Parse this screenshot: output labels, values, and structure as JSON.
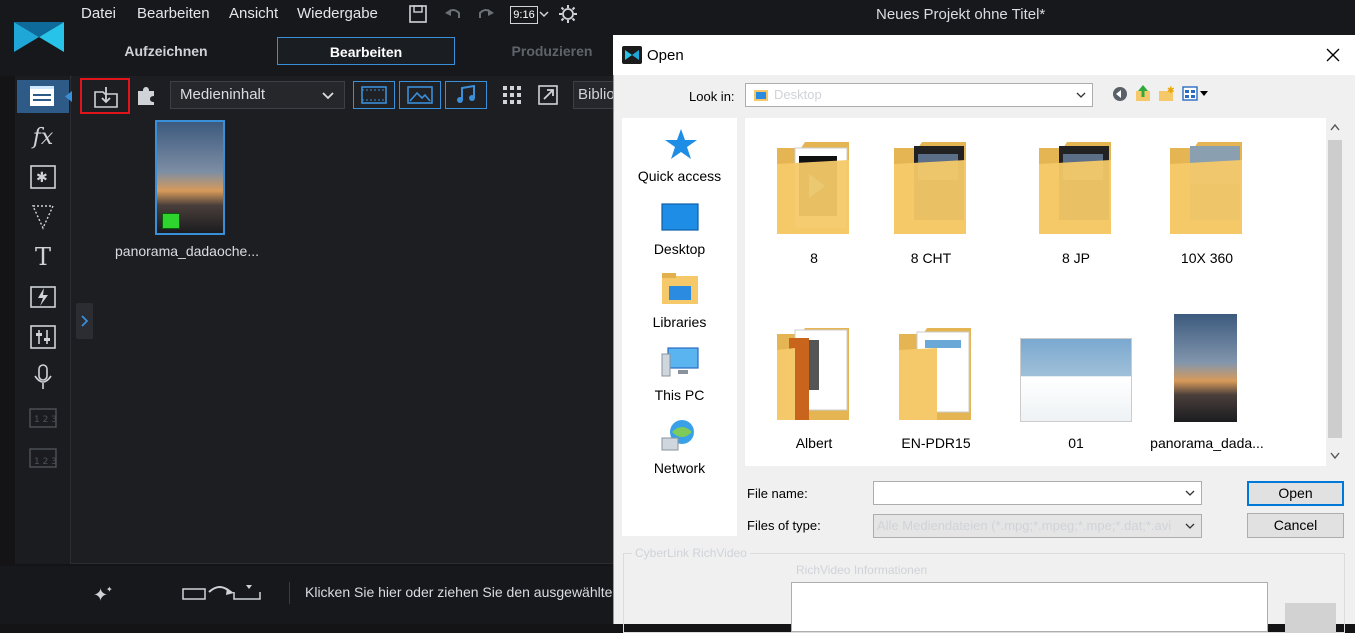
{
  "app": {
    "menu": [
      "Datei",
      "Bearbeiten",
      "Ansicht",
      "Wiedergabe"
    ],
    "title": "Neues Projekt ohne Titel*",
    "aspect_ratio": "9:16"
  },
  "modes": {
    "record": "Aufzeichnen",
    "edit": "Bearbeiten",
    "produce": "Produzieren"
  },
  "library": {
    "dropdown_value": "Medieninhalt",
    "library_button": "Bibliothek",
    "media_item": "panorama_dadaoche..."
  },
  "bottom_hint": "Klicken Sie hier oder ziehen Sie den ausgewählten Clip hierher",
  "dialog": {
    "title": "Open",
    "look_in_label": "Look in:",
    "look_in_value": "Desktop",
    "places": [
      "Quick access",
      "Desktop",
      "Libraries",
      "This PC",
      "Network"
    ],
    "items": [
      "8",
      "8 CHT",
      "8 JP",
      "10X 360",
      "Albert",
      "EN-PDR15",
      "01",
      "panorama_dada..."
    ],
    "file_name_label": "File name:",
    "file_name_value": "",
    "files_of_type_label": "Files of type:",
    "files_of_type_value": "Alle Mediendateien (*.mpg;*.mpeg;*.mpe;*.dat;*.avi",
    "open_button": "Open",
    "cancel_button": "Cancel",
    "richvideo_group": "CyberLink RichVideo",
    "richvideo_info_label": "RichVideo Informationen"
  },
  "colors": {
    "accent": "#3a8fd9",
    "highlight_red": "#e0141b",
    "dialog_bg": "#f0f0f0",
    "folder_yellow": "#f5c969"
  }
}
